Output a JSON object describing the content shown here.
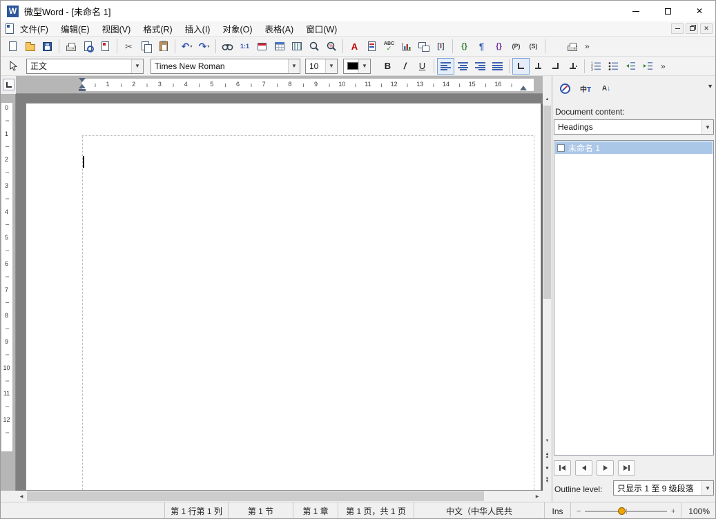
{
  "window": {
    "title": "微型Word - [未命名 1]",
    "app_initial": "W"
  },
  "menubar": {
    "items": [
      "文件(F)",
      "编辑(E)",
      "视图(V)",
      "格式(R)",
      "插入(I)",
      "对象(O)",
      "表格(A)",
      "窗口(W)"
    ]
  },
  "toolbar1": {
    "icon_names": [
      "new-document",
      "open-folder",
      "save",
      "print",
      "print-preview",
      "export-page",
      "cut-scissors",
      "copy",
      "paste",
      "undo",
      "redo",
      "find-binoculars",
      "zoom-one-to-one",
      "data-source-window",
      "insert-table",
      "columns",
      "zoom-magnifier",
      "zoom-percent",
      "font-red-a",
      "format-page",
      "spellcheck-abc",
      "chart",
      "frames",
      "index-i",
      "fields-braces",
      "pilcrow",
      "script-braces",
      "paren-p",
      "paren-s",
      "printer-options"
    ],
    "one_to_one": "1:1",
    "red_a": "A",
    "abc": "ABC",
    "index": "I",
    "fields": "{}",
    "pilcrow": "¶",
    "braces": "{}",
    "paren_p": "(P)",
    "paren_s": "(S)",
    "overflow": "»"
  },
  "toolbar2": {
    "icon_names": [
      "select-pointer",
      "align-left",
      "align-center",
      "align-right",
      "align-justify",
      "tab-left",
      "tab-center",
      "tab-right",
      "tab-decimal",
      "numbered-list",
      "bulleted-list",
      "increase-indent",
      "decrease-indent"
    ],
    "style": "正文",
    "font": "Times New Roman",
    "size": "10",
    "bold": "B",
    "italic": "/",
    "underline": "U",
    "overflow": "»"
  },
  "ruler": {
    "h_numbers": [
      "1",
      "2",
      "3",
      "4",
      "5",
      "6",
      "7",
      "8",
      "9",
      "10",
      "11",
      "12",
      "13",
      "14",
      "15",
      "16"
    ],
    "v_numbers": [
      "0",
      "1",
      "2",
      "3",
      "4",
      "5",
      "6",
      "7",
      "8",
      "9",
      "10",
      "11",
      "12"
    ]
  },
  "sidebar": {
    "content_label": "Document content:",
    "content_value": "Headings",
    "items": [
      {
        "label": "未命名 1",
        "state": "selected"
      }
    ],
    "outline_label": "Outline level:",
    "outline_value": "只显示 1 至 9 级段落"
  },
  "statusbar": {
    "segments": [
      "",
      "第 1 行第 1 列",
      "第 1 节",
      "第 1 章",
      "第 1 页，共 1 页",
      "中文（中华人民共",
      "Ins"
    ],
    "zoom_level": "100%"
  }
}
